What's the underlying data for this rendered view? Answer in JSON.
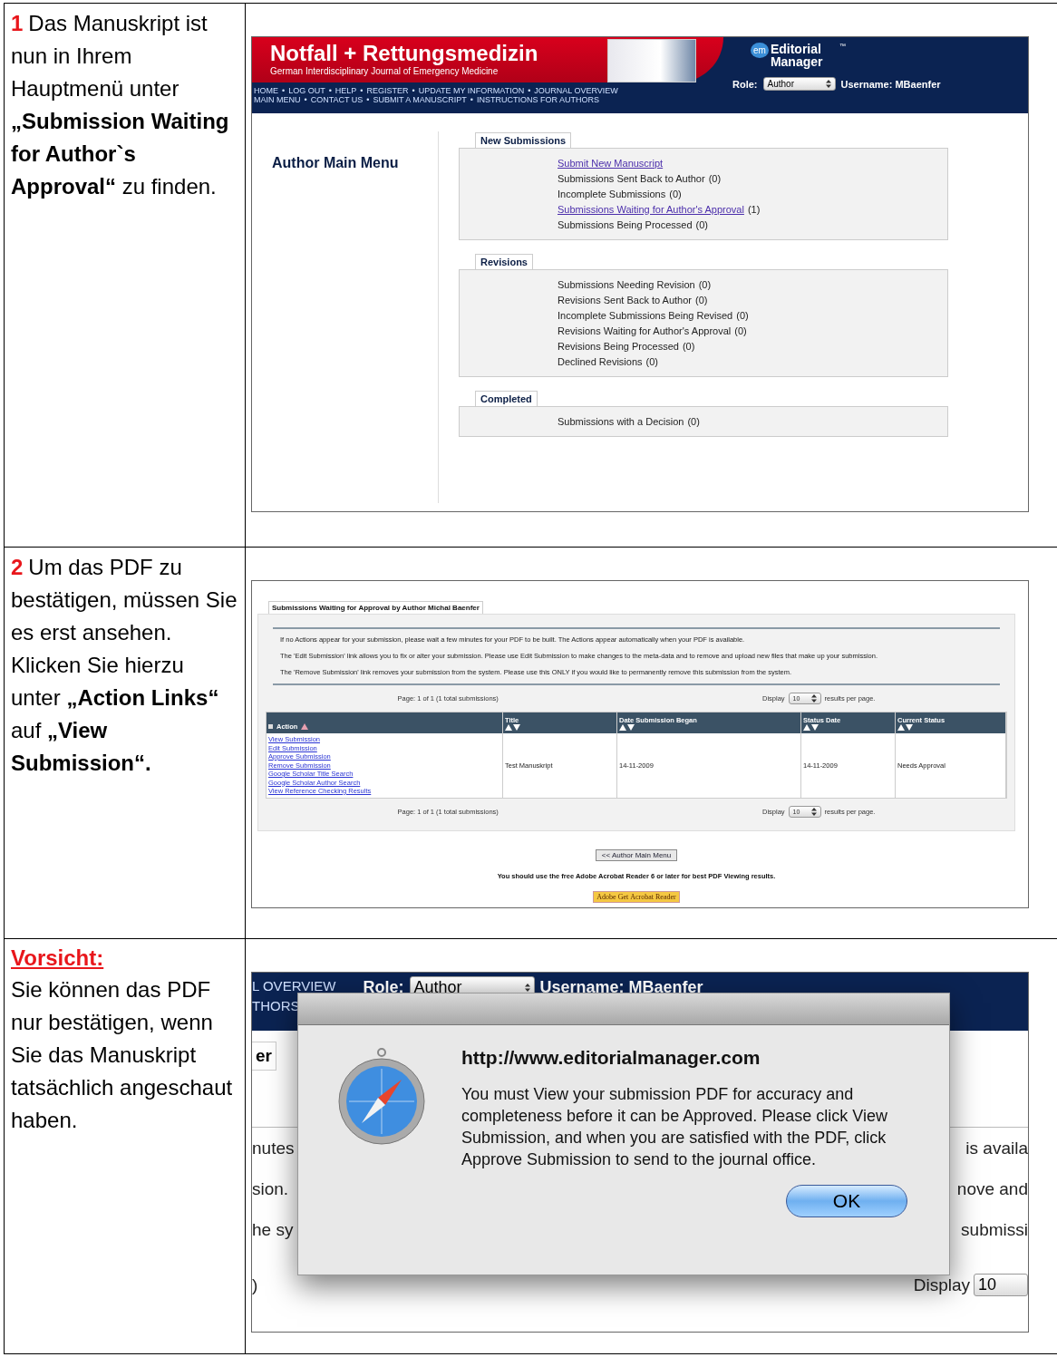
{
  "steps": [
    {
      "number": "1",
      "text": "Das Manuskript ist nun in Ihrem Hauptmenü unter **„Submission Waiting for Author`s Approval“** zu finden.",
      "screenshot": {
        "kind": "main_menu",
        "journal_title": "Notfall + Rettungsmedizin",
        "journal_subtitle": "German Interdisciplinary Journal of Emergency Medicine",
        "logo_badge": "em",
        "logo_text": "Editorial Manager",
        "logo_mark": "™",
        "nav_separator": "•",
        "nav_rows": [
          [
            "HOME",
            "LOG OUT",
            "HELP",
            "REGISTER",
            "UPDATE MY INFORMATION",
            "JOURNAL OVERVIEW"
          ],
          [
            "MAIN MENU",
            "CONTACT US",
            "SUBMIT A MANUSCRIPT",
            "INSTRUCTIONS FOR AUTHORS"
          ]
        ],
        "role_label": "Role:",
        "role_value": "Author",
        "username": "Username: MBaenfer",
        "sidebar_title": "Author Main Menu",
        "sections": [
          {
            "title": "New Submissions",
            "items": [
              {
                "label": "Submit New Manuscript",
                "link": true
              },
              {
                "label": "Submissions Sent Back to Author",
                "count": "(0)",
                "link": false
              },
              {
                "label": "Incomplete Submissions",
                "count": "(0)",
                "link": false
              },
              {
                "label": "Submissions Waiting for Author's Approval",
                "count": "(1)",
                "link": true
              },
              {
                "label": "Submissions Being Processed",
                "count": "(0)",
                "link": false
              }
            ]
          },
          {
            "title": "Revisions",
            "items": [
              {
                "label": "Submissions Needing Revision",
                "count": "(0)",
                "link": false
              },
              {
                "label": "Revisions Sent Back to Author",
                "count": "(0)",
                "link": false
              },
              {
                "label": "Incomplete Submissions Being Revised",
                "count": "(0)",
                "link": false
              },
              {
                "label": "Revisions Waiting for Author's Approval",
                "count": "(0)",
                "link": false
              },
              {
                "label": "Revisions Being Processed",
                "count": "(0)",
                "link": false
              },
              {
                "label": "Declined Revisions",
                "count": "(0)",
                "link": false
              }
            ]
          },
          {
            "title": "Completed",
            "items": [
              {
                "label": "Submissions with a Decision",
                "count": "(0)",
                "link": false
              }
            ]
          }
        ]
      }
    },
    {
      "number": "2",
      "text": "Um das PDF zu bestätigen, müssen Sie es erst ansehen. Klicken Sie hierzu unter **„Action Links“** auf **„View Submission“.**",
      "screenshot": {
        "kind": "waiting_list",
        "panel_title": "Submissions Waiting for Approval by Author Michal Baenfer",
        "notes": [
          "If no Actions appear for your submission, please wait a few minutes for your PDF to be built. The Actions appear automatically when your PDF is available.",
          "The 'Edit Submission' link allows you to fix or alter your submission. Please use Edit Submission to make changes to the meta-data and to remove and upload new files that make up your submission.",
          "The 'Remove Submission' link removes your submission from the system. Please use this ONLY if you would like to permanently remove this submission from the system."
        ],
        "pagers": [
          {
            "page": "Page: 1 of 1 (1 total submissions)",
            "display": "Display",
            "per_page": "10",
            "suffix": "results per page."
          },
          {
            "page": "Page: 1 of 1 (1 total submissions)",
            "display": "Display",
            "per_page": "10",
            "suffix": "results per page."
          }
        ],
        "columns": [
          "Action",
          "Title",
          "Date Submission Began",
          "Status Date",
          "Current Status"
        ],
        "row": {
          "actions": [
            "View Submission",
            "Edit Submission",
            "Approve Submission",
            "Remove Submission",
            "Google Scholar Title Search",
            "Google Scholar Author Search",
            "View Reference Checking Results"
          ],
          "cells": [
            "Test Manuskript",
            "14-11-2009",
            "14-11-2009",
            "Needs Approval"
          ]
        },
        "back_button": "<< Author Main Menu",
        "reader_note": "You should use the free Adobe Acrobat Reader 6 or later for best PDF Viewing results.",
        "reader_badge": {
          "get": "Get",
          "name": "Acrobat Reader",
          "brand": "Adobe"
        }
      }
    },
    {
      "heading": "Vorsicht:",
      "text": "Sie können das PDF nur bestätigen, wenn Sie das Manuskript tatsächlich angeschaut haben.",
      "screenshot": {
        "kind": "alert",
        "nav_fragments": [
          "L OVERVIEW",
          "THORS"
        ],
        "role_label": "Role:",
        "role_value": "Author",
        "username": "Username: MBaenfer",
        "tab_fragment": "er",
        "line_fragments": [
          [
            "nutes",
            "is availa"
          ],
          [
            "sion.",
            "nove and"
          ],
          [
            "he sy",
            "submissi"
          ]
        ],
        "pager_fragment": ")",
        "display": "Display",
        "per_page": "10",
        "dialog": {
          "title": "http://www.editorialmanager.com",
          "message": "You must View your submission PDF for accuracy and completeness before it can be Approved. Please click View Submission, and when you are satisfied with the PDF, click Approve Submission to send to the journal office.",
          "button": "OK"
        }
      }
    }
  ]
}
